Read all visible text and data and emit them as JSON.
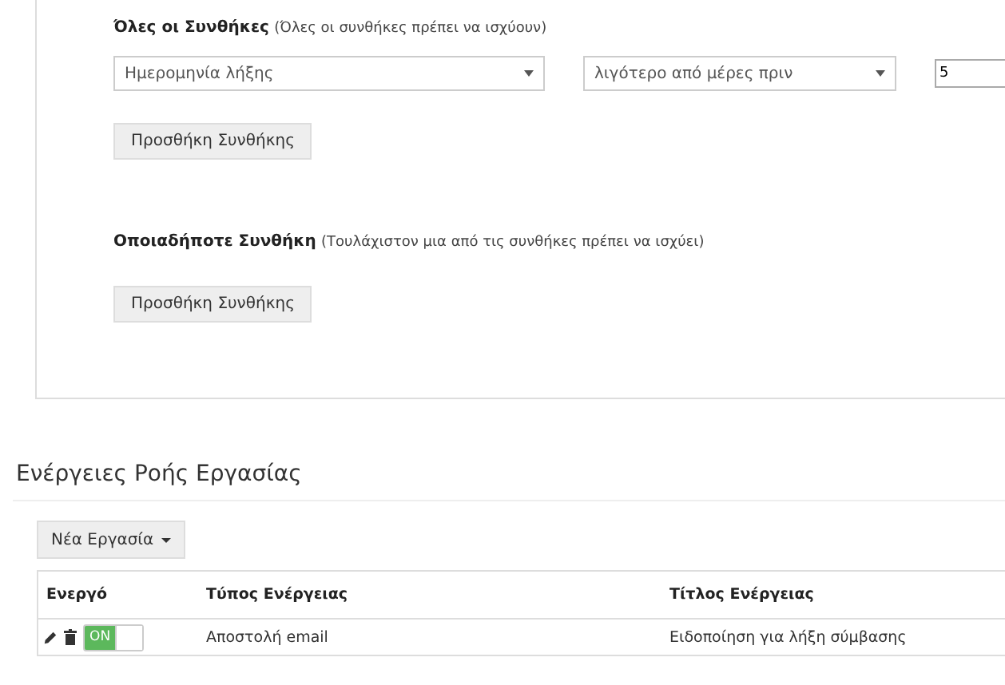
{
  "all_conditions": {
    "title": "Όλες οι Συνθήκες",
    "hint": "(Όλες οι συνθήκες πρέπει να ισχύουν)",
    "rows": [
      {
        "field": "Ημερομηνία λήξης",
        "operator": "λιγότερο από μέρες πριν",
        "value": "5"
      }
    ],
    "add_button": "Προσθήκη Συνθήκης"
  },
  "any_conditions": {
    "title": "Οποιαδήποτε Συνθήκη",
    "hint": "(Τουλάχιστον μια από τις συνθήκες πρέπει να ισχύει)",
    "add_button": "Προσθήκη Συνθήκης"
  },
  "workflow": {
    "title": "Ενέργειες Ροής Εργασίας",
    "new_button": "Νέα Εργασία",
    "table": {
      "columns": [
        "Ενεργό",
        "Τύπος Ενέργειας",
        "Τίτλος Ενέργειας"
      ],
      "rows": [
        {
          "on": true,
          "toggle_label": "ON",
          "type": "Αποστολή email",
          "title": "Ειδοποίηση για λήξη σύμβασης"
        }
      ]
    }
  }
}
